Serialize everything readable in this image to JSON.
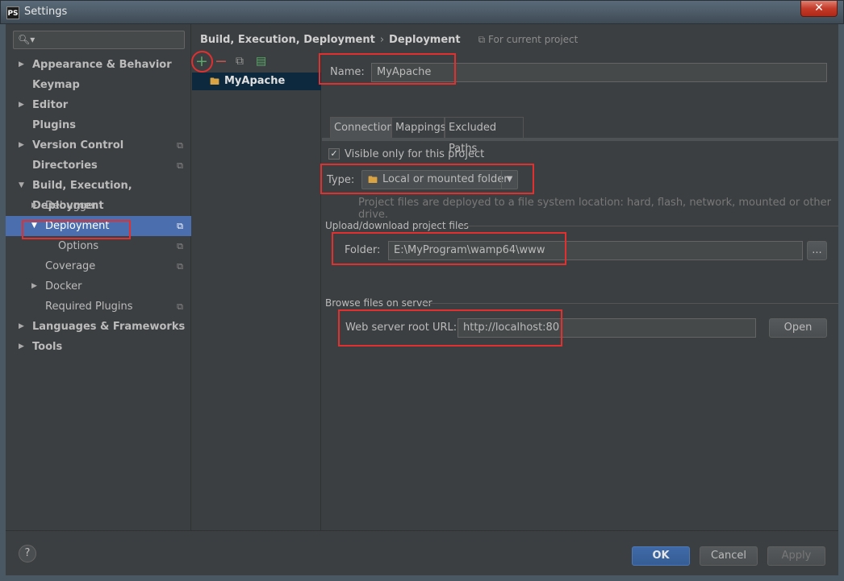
{
  "window": {
    "title": "Settings",
    "app_badge": "PS",
    "close_glyph": "✕"
  },
  "search": {
    "placeholder": ""
  },
  "sidebar": {
    "items": [
      {
        "label": "Appearance & Behavior"
      },
      {
        "label": "Keymap"
      },
      {
        "label": "Editor"
      },
      {
        "label": "Plugins"
      },
      {
        "label": "Version Control"
      },
      {
        "label": "Directories"
      },
      {
        "label": "Build, Execution, Deployment"
      },
      {
        "label": "Debugger"
      },
      {
        "label": "Deployment"
      },
      {
        "label": "Options"
      },
      {
        "label": "Coverage"
      },
      {
        "label": "Docker"
      },
      {
        "label": "Required Plugins"
      },
      {
        "label": "Languages & Frameworks"
      },
      {
        "label": "Tools"
      }
    ]
  },
  "breadcrumb": {
    "parent": "Build, Execution, Deployment",
    "separator": "›",
    "current": "Deployment",
    "scope": "For current project"
  },
  "servers": {
    "items": [
      {
        "name": "MyApache"
      }
    ]
  },
  "form": {
    "name_label": "Name:",
    "name_value": "MyApache",
    "tabs": [
      {
        "label": "Connection"
      },
      {
        "label": "Mappings"
      },
      {
        "label": "Excluded Paths"
      }
    ],
    "visible_only_label": "Visible only for this project",
    "type_label": "Type:",
    "type_value": "Local or mounted folder",
    "type_hint": "Project files are deployed to a file system location: hard, flash, network, mounted or other drive.",
    "upload_section": "Upload/download project files",
    "folder_label": "Folder:",
    "folder_value": "E:\\MyProgram\\wamp64\\www",
    "browse_label": "...",
    "browse_section": "Browse files on server",
    "web_root_label": "Web server root URL:",
    "web_root_value": "http://localhost:80",
    "open_label": "Open"
  },
  "footer": {
    "help": "?",
    "ok": "OK",
    "cancel": "Cancel",
    "apply": "Apply"
  },
  "colors": {
    "accent": "#4b6eaf",
    "annotation": "#e03030",
    "background": "#3c3f41"
  }
}
